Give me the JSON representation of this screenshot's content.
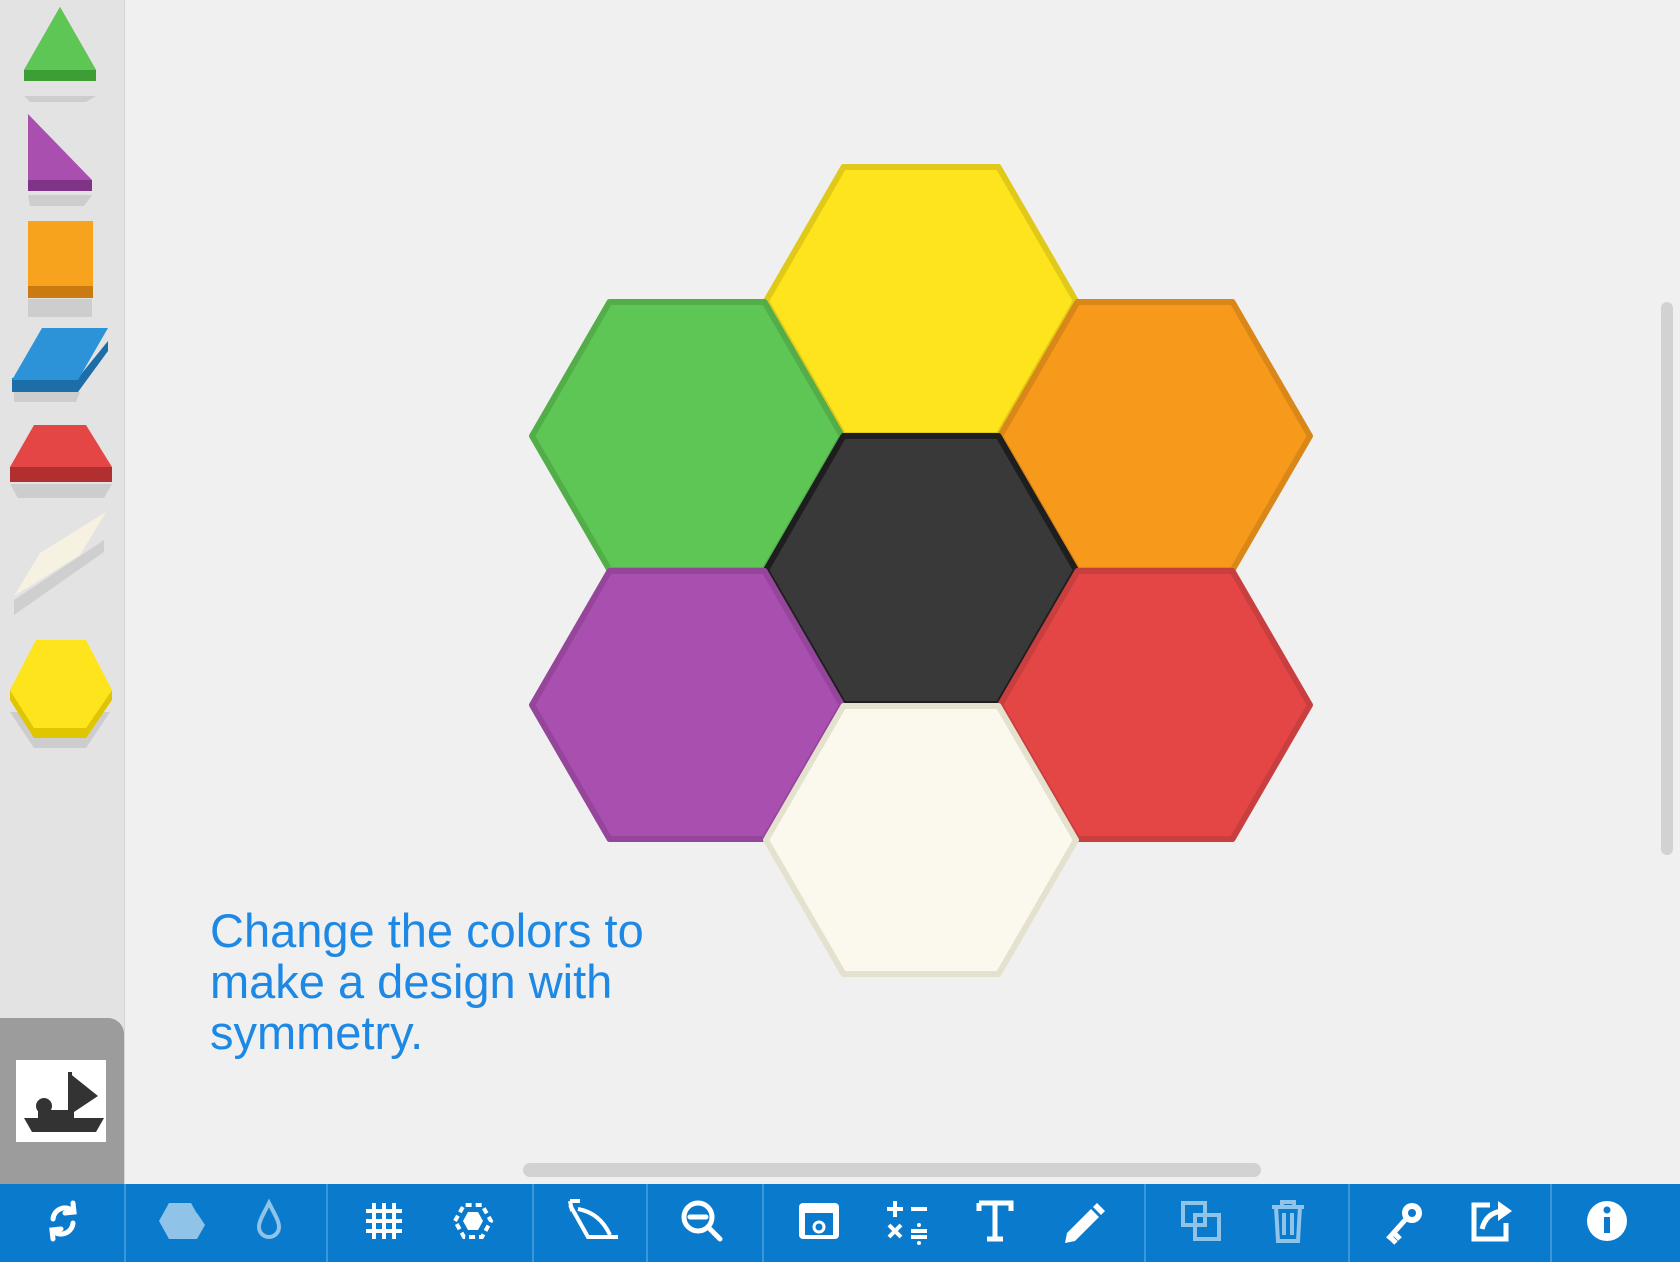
{
  "palette": {
    "shapes": [
      {
        "name": "triangle",
        "color": "#5ec654"
      },
      {
        "name": "right-triangle",
        "color": "#a94fb0"
      },
      {
        "name": "square",
        "color": "#f7a31e"
      },
      {
        "name": "parallelogram",
        "color": "#2d93d9"
      },
      {
        "name": "trapezoid",
        "color": "#e44646"
      },
      {
        "name": "thin-rhombus",
        "color": "#f7f1e2"
      },
      {
        "name": "hexagon",
        "color": "#fee41c"
      }
    ],
    "stamp_icon": "stamp-icon"
  },
  "canvas": {
    "instruction": "Change the colors to make a design with symmetry.",
    "hexagons": [
      {
        "position": "top",
        "color": "#fee41c"
      },
      {
        "position": "upper-left",
        "color": "#5ec654"
      },
      {
        "position": "upper-right",
        "color": "#f7991b"
      },
      {
        "position": "center",
        "color": "#393939"
      },
      {
        "position": "lower-left",
        "color": "#a94fb0"
      },
      {
        "position": "lower-right",
        "color": "#e44646"
      },
      {
        "position": "bottom",
        "color": "#fbf8ee"
      }
    ]
  },
  "toolbar": {
    "background": "#0a7bcc",
    "buttons": [
      {
        "name": "refresh-icon",
        "enabled": true
      },
      {
        "name": "shapes-icon",
        "enabled": false
      },
      {
        "name": "color-drop-icon",
        "enabled": false
      },
      {
        "name": "grid-icon",
        "enabled": true
      },
      {
        "name": "select-icon",
        "enabled": true
      },
      {
        "name": "angle-icon",
        "enabled": true
      },
      {
        "name": "zoom-out-icon",
        "enabled": true
      },
      {
        "name": "background-icon",
        "enabled": true
      },
      {
        "name": "operations-icon",
        "enabled": true
      },
      {
        "name": "text-icon",
        "enabled": true
      },
      {
        "name": "pencil-icon",
        "enabled": true
      },
      {
        "name": "duplicate-icon",
        "enabled": false
      },
      {
        "name": "trash-icon",
        "enabled": false
      },
      {
        "name": "key-icon",
        "enabled": true
      },
      {
        "name": "share-icon",
        "enabled": true
      },
      {
        "name": "info-icon",
        "enabled": true
      }
    ]
  }
}
